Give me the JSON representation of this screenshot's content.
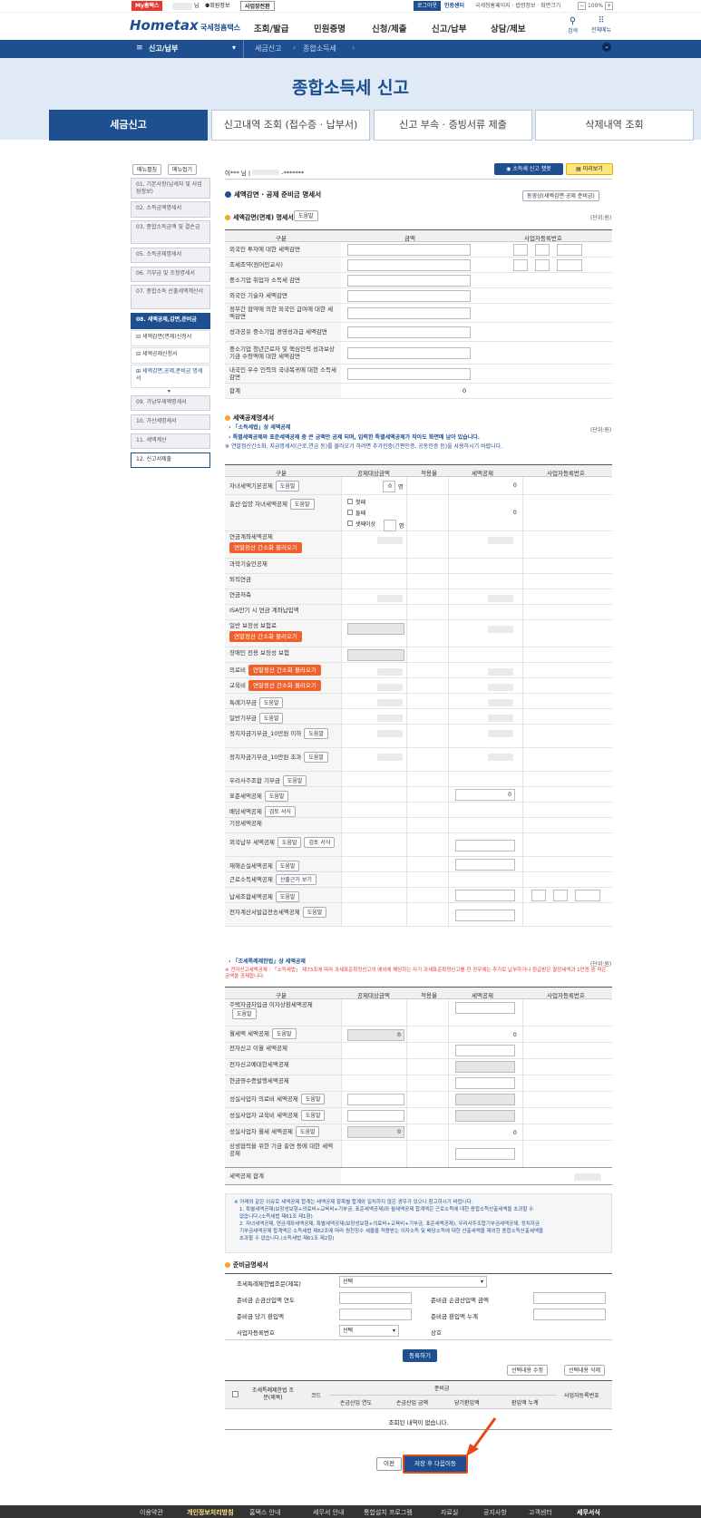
{
  "topbar": {
    "my_hometax": "My홈택스",
    "user": "님",
    "member_info": "회원정보",
    "business_switch": "사업장전환",
    "logout": "로그아웃",
    "cert_center": "인증센터",
    "links": "국세청홈페이지 · 법령정보 · 화면크기",
    "zoom": "100%"
  },
  "header": {
    "logo": "Hometax",
    "logo_sub": "국세청홈택스",
    "menus": [
      "조회/발급",
      "민원증명",
      "신청/제출",
      "신고/납부",
      "상담/제보"
    ],
    "search": "검색",
    "all_menu": "전체메뉴"
  },
  "nav": {
    "current": "신고/납부",
    "crumb1": "세금신고",
    "crumb2": "종합소득세"
  },
  "page_title": "종합소득세 신고",
  "tabs": [
    "세금신고",
    "신고내역 조회 (접수증 · 납부서)",
    "신고 부속 · 증빙서류 제출",
    "삭제내역 조회"
  ],
  "sidebar": {
    "expand": "메뉴펼침",
    "collapse": "메뉴접기",
    "items": [
      "01. 기본사항(납세자 및 사업장정보)",
      "02. 소득금액명세서",
      "03. 종합소득금액 및 결손금",
      "05. 소득공제명세서",
      "06. 기부금 및 조정명세서",
      "07. 종합소득 산출세액계산서",
      "08. 세액공제,감면,준비금",
      "09. 가납부세액명세서",
      "10. 가산세명세서",
      "11. 세액계산",
      "12. 신고서제출"
    ],
    "subs": [
      "세액감면(면제)신청서",
      "세액공제신청서",
      "세액감면,공제,준비금 명세서"
    ]
  },
  "user_line": {
    "name": "이*** 님",
    "id": "-*******"
  },
  "chatbot": "소득세 신고 챗봇",
  "preview": "미리보기",
  "main_title": "세액감면 · 공제 준비금 명세서",
  "video_btn": "동영상(세액감면·공제 준비금)",
  "s1": {
    "title": "세액감면(면제) 명세서",
    "help": "도움말",
    "unit": "(단위:원)",
    "h_div": "구분",
    "h_amt": "금액",
    "h_biz": "사업자등록번호",
    "rows": [
      "외국인 투자에 대한 세액감면",
      "조세조약(원어민교사)",
      "중소기업 취업자 소득세 감면",
      "외국인 기술자 세액감면",
      "정부간 협약에 의한 외국인 급여에 대한 세액감면",
      "성과공유 중소기업 경영성과급 세액감면",
      "중소기업 청년근로자 및 핵심인력 성과보상기금 수령액에 대한 세액감면",
      "내국인 우수 인력의 국내복귀에 대한 소득세 감면",
      "합계"
    ],
    "total": "0"
  },
  "s2": {
    "title": "세액공제명세서",
    "sub": "「소득세법」상 세액공제",
    "unit": "(단위:원)",
    "note1": "특별세액공제와 표준세액공제 중 큰 금액만 공제 되며, 입력한 특별세액공제가 작아도 화면에 남아 있습니다.",
    "note2": "연말정산간소화, 지급명세서(근로,연금 등)를 불러오기 하려면 추가인증(간편인증, 공동인증 등)을 사용하시기 바랍니다.",
    "h_div": "구분",
    "h_base": "공제대상금액",
    "h_rate": "적용율",
    "h_credit": "세액공제",
    "h_biz": "사업자등록번호",
    "rows": [
      "자녀세액기본공제",
      "출산·입양 자녀세액공제",
      "연금계좌세액공제",
      "과학기술인공제",
      "퇴직연금",
      "연금저축",
      "ISA만기 시 연금 계좌납입액",
      "일반 보장성 보험료",
      "장애인 전용 보장성 보험",
      "의료비",
      "교육비",
      "특례기부금",
      "일반기부금",
      "정치자금기부금_10만원 이하",
      "정치자금기부금_10만원 초과",
      "우리사주조합 기부금",
      "표준세액공제",
      "배당세액공제",
      "기장세액공제",
      "외국납부 세액공제",
      "재해손실세액공제",
      "근로소득세액공제",
      "납세조합세액공제",
      "전자계산서발급전송세액공제"
    ],
    "child_count": "0",
    "unit_person": "명",
    "credit_zero": "0",
    "births": [
      "첫째",
      "둘째",
      "셋째이상"
    ],
    "load_btn": "연말정산 간소화 불러오기",
    "review": "검토 서식",
    "calc": "산출근거 보기"
  },
  "s3": {
    "sub": "「조세특례제한법」상 세액공제",
    "unit": "(단위:원)",
    "note": "※ 전자신고세액공제 : 「소득세법」 제73조에 따라 과세표준확정신고의 예외에 해당하는 자가 과세표준확정신고를 한 경우에는 추가로 납부하거나 환급받은 결정세액과 1만원 중 적은 금액을 공제합니다.",
    "h_div": "구분",
    "h_base": "공제대상금액",
    "h_rate": "적용율",
    "h_credit": "세액공제",
    "h_biz": "사업자등록번호",
    "rows": [
      "주택자금차입금 이자상환세액공제",
      "월세액 세액공제",
      "전자신고 이월 세액공제",
      "전자신고예대한세액공제",
      "현금영수증발행세액공제",
      "성실사업자 의료비 세액공제",
      "성실사업자 교육비 세액공제",
      "성실사업자 월세 세액공제",
      "상생협력을 위한 기금 출연 등에 대한 세액공제"
    ],
    "total_label": "세액공제 합계"
  },
  "notes": [
    "※ 아래와 같은 이유로 세액공제 합계는 세액공제 항목별 합계와 일치하지 않은 경우가 있으니 참고하시기 바랍니다.",
    "1. 특별세액공제(보장성보험+의료비+교육비+기부금, 표준세액공제)와 월세액공제 합계액은 근로소득에 대한 종합소득산출세액을 초과할 수",
    "없습니다.(소득세법 제61조 제1항)",
    "2. 자녀세액공제, 연금계좌세액공제, 특별세액공제(보장성보험+의료비+교육비+기부금, 표준세액공제), 우리사주조합기부금세액공제, 정치자금",
    "기부금세액공제 합계액은 소득세법 제62조에 따라 원천징수 세율을 적용받는 이자소득 및 배당소득에 대한 산출세액을 제외한 종합소득산출세액을",
    "초과할 수 없습니다.(소득세법 제61조 제2항)"
  ],
  "reserve": {
    "title": "준비금명세서",
    "law_label": "조세특례제한법조문(제목)",
    "law_value": "선택",
    "year_label": "준비금 손금산입액 연도",
    "amount_label": "준비금 손금산입액 금액",
    "current_label": "준비금 당기 환입액",
    "cumulative_label": "준비금 환입액 누계",
    "biz_label": "사업자등록번호",
    "biz_value": "선택",
    "name_label": "상호",
    "register": "등록하기",
    "modify": "선택내용 수정",
    "delete": "선택내용 삭제",
    "cols": [
      "조세특례제한법 조문(제목)",
      "코드",
      "준비금",
      "손금산입 연도",
      "손금산입 금액",
      "당기환입액",
      "환입액 누계",
      "사업자등록번호"
    ],
    "empty": "조회된 내역이 없습니다."
  },
  "bottom": {
    "prev": "이전",
    "save_next": "저장 후 다음이동"
  },
  "footer": [
    "이용약관",
    "개인정보처리방침",
    "홈택스 안내",
    "세무서 안내",
    "통합설치 프로그램",
    "자료실",
    "공지사항",
    "고객센터",
    "세무서식"
  ]
}
